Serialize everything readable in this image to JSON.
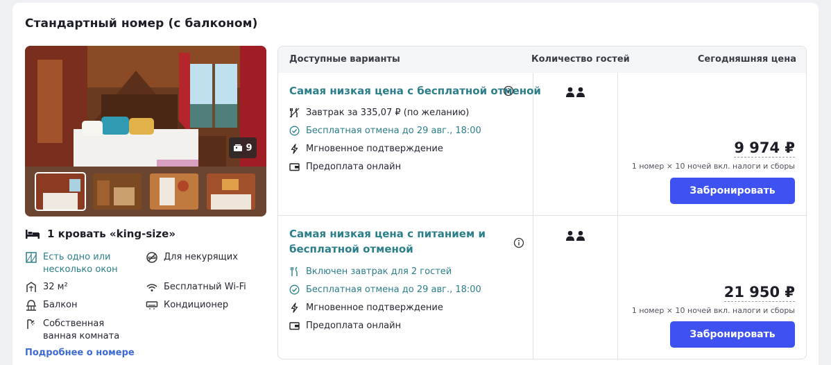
{
  "room": {
    "title": "Стандартный номер (с балконом)",
    "photo_count": "9",
    "bed": "1 кровать «king-size»",
    "more_link": "Подробнее о номере"
  },
  "amenities": [
    {
      "icon": "window-icon",
      "label": "Есть одно или несколько окон"
    },
    {
      "icon": "no-smoking-icon",
      "label": "Для некурящих"
    },
    {
      "icon": "area-icon",
      "label": "32 м²"
    },
    {
      "icon": "wifi-icon",
      "label": "Бесплатный Wi-Fi"
    },
    {
      "icon": "balcony-icon",
      "label": "Балкон"
    },
    {
      "icon": "air-conditioner-icon",
      "label": "Кондиционер"
    },
    {
      "icon": "shower-icon",
      "label": "Собственная ванная комната"
    }
  ],
  "table": {
    "col_options": "Доступные варианты",
    "col_guests": "Количество гостей",
    "col_price": "Сегодняшняя цена"
  },
  "options": [
    {
      "title": "Самая низкая цена с бесплатной отменой",
      "features": [
        "Завтрак за 335,07 ₽ (по желанию)",
        "Бесплатная отмена до 29 авг., 18:00",
        "Мгновенное подтверждение",
        "Предоплата онлайн"
      ],
      "price": "9 974 ₽",
      "price_note": "1 номер × 10 ночей вкл. налоги и сборы",
      "book_label": "Забронировать"
    },
    {
      "title_line1": "Самая низкая цена с питанием и",
      "title_line2": "бесплатной отменой",
      "features": [
        "Включен завтрак для 2 гостей",
        "Бесплатная отмена до 29 авг., 18:00",
        "Мгновенное подтверждение",
        "Предоплата онлайн"
      ],
      "price": "21 950 ₽",
      "price_note": "1 номер × 10 ночей вкл. налоги и сборы",
      "book_label": "Забронировать"
    }
  ],
  "colors": {
    "accent_teal": "#2c7f8a",
    "button_blue": "#3d52f0",
    "link_blue": "#3d6ad6"
  }
}
